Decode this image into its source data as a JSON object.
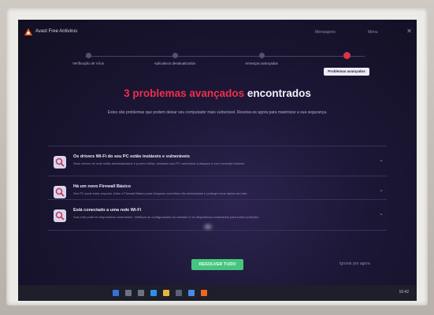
{
  "app": {
    "title": "Avast Free Antivirus",
    "links": [
      "Mensagens",
      "Menu"
    ]
  },
  "steps": [
    {
      "label": "Verificação de Vírus"
    },
    {
      "label": "Aplicativos desatualizados"
    },
    {
      "label": "Ameaças avançadas"
    },
    {
      "label": "Problemas avançados",
      "active": true
    }
  ],
  "headline": {
    "count_part": "3 problemas avançados",
    "rest_part": "encontrados"
  },
  "subtitle": "Estes são problemas que podem deixar seu computador mais vulnerável. Resolva-os agora para maximizar a sua segurança.",
  "issues": [
    {
      "title": "Os drivers Wi-Fi do seu PC estão instáveis e vulneráveis",
      "desc": "Seus drivers de rede estão desatualizados e podem falhar, deixando seu PC vulnerável a ataques e com conexão instável."
    },
    {
      "title": "Há um novo Firewall Básico",
      "desc": "Seu PC pode estar exposto. Ative o Firewall Básico para bloquear conexões não autorizadas e proteger seus dados na rede."
    },
    {
      "title": "Está conectado a uma rede Wi-Fi",
      "desc": "Sua rede pode ter dispositivos vulneráveis. Verifique as configurações do roteador e os dispositivos conectados para maior proteção."
    }
  ],
  "actions": {
    "fix_label": "RESOLVER TUDO",
    "skip_label": "Ignorar por agora"
  },
  "taskbar": {
    "clock": "10:42"
  },
  "colors": {
    "accent_red": "#ee2f4e",
    "button_green": "#45c57f",
    "background": "#1b1634"
  }
}
